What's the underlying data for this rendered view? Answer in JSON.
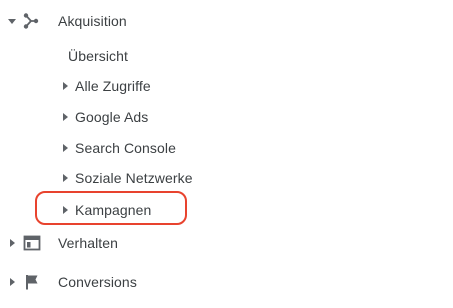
{
  "nav": {
    "acquisition": {
      "label": "Akquisition",
      "icon": "acquisition-icon",
      "expanded": true,
      "children": [
        {
          "label": "Übersicht",
          "has_arrow": false
        },
        {
          "label": "Alle Zugriffe",
          "has_arrow": true
        },
        {
          "label": "Google Ads",
          "has_arrow": true
        },
        {
          "label": "Search Console",
          "has_arrow": true
        },
        {
          "label": "Soziale Netzwerke",
          "has_arrow": true
        },
        {
          "label": "Kampagnen",
          "has_arrow": true,
          "highlighted": true
        }
      ]
    },
    "behavior": {
      "label": "Verhalten",
      "icon": "behavior-window-icon",
      "expanded": false
    },
    "conversions": {
      "label": "Conversions",
      "icon": "flag-icon",
      "expanded": false
    }
  },
  "colors": {
    "text": "#3c4043",
    "icon": "#5f6368",
    "highlight": "#e8432e"
  }
}
